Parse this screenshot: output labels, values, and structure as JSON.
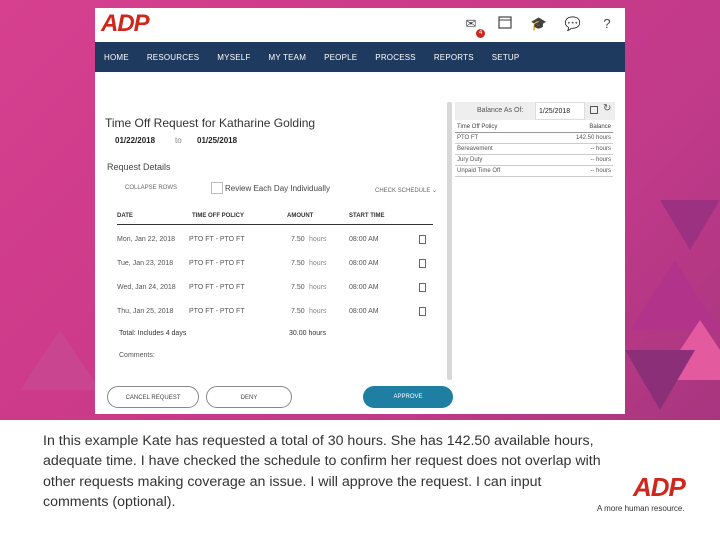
{
  "app": {
    "logo": "ADP",
    "mail_count": "4",
    "calendar_day": "27"
  },
  "nav": [
    "HOME",
    "RESOURCES",
    "MYSELF",
    "MY TEAM",
    "PEOPLE",
    "PROCESS",
    "REPORTS",
    "SETUP"
  ],
  "request": {
    "title": "Time Off Request for Katharine Golding",
    "from": "01/22/2018",
    "to_label": "to",
    "to": "01/25/2018",
    "section": "Request Details",
    "collapse_rows": "COLLAPSE ROWS",
    "review_each": "Review Each Day Individually",
    "check_schedule": "CHECK SCHEDULE"
  },
  "table": {
    "headers": [
      "DATE",
      "TIME OFF POLICY",
      "AMOUNT",
      "START TIME"
    ],
    "rows": [
      {
        "date": "Mon, Jan 22, 2018",
        "policy": "PTO FT - PTO FT",
        "amount": "7.50",
        "unit": "hours",
        "start": "08:00 AM"
      },
      {
        "date": "Tue, Jan 23, 2018",
        "policy": "PTO FT - PTO FT",
        "amount": "7.50",
        "unit": "hours",
        "start": "08:00 AM"
      },
      {
        "date": "Wed, Jan 24, 2018",
        "policy": "PTO FT - PTO FT",
        "amount": "7.50",
        "unit": "hours",
        "start": "08:00 AM"
      },
      {
        "date": "Thu, Jan 25, 2018",
        "policy": "PTO FT - PTO FT",
        "amount": "7.50",
        "unit": "hours",
        "start": "08:00 AM"
      }
    ],
    "total_label": "Total: Includes 4 days",
    "total_amount": "30.00 hours",
    "comments": "Comments:"
  },
  "buttons": {
    "cancel": "CANCEL REQUEST",
    "deny": "DENY",
    "approve": "APPROVE"
  },
  "balance": {
    "as_of_label": "Balance As Of:",
    "as_of_date": "1/25/2018",
    "col_policy": "Time Off Policy",
    "col_balance": "Balance",
    "rows": [
      {
        "policy": "PTO FT",
        "balance": "142.50 hours"
      },
      {
        "policy": "Bereavement",
        "balance": "-- hours"
      },
      {
        "policy": "Jury Duty",
        "balance": "-- hours"
      },
      {
        "policy": "Unpaid Time Off",
        "balance": "-- hours"
      }
    ]
  },
  "caption": "In this example Kate has requested a total of 30 hours. She has 142.50 available hours, adequate time. I have checked the schedule to confirm her request does not overlap with other requests making coverage an issue. I will approve the request. I can input comments (optional).",
  "footer": {
    "logo": "ADP",
    "tagline": "A more human resource."
  },
  "colors": {
    "nav": "#1f3a5f",
    "accent": "#d0271d",
    "approve": "#1e7fa3",
    "slide": "#d6408f"
  }
}
